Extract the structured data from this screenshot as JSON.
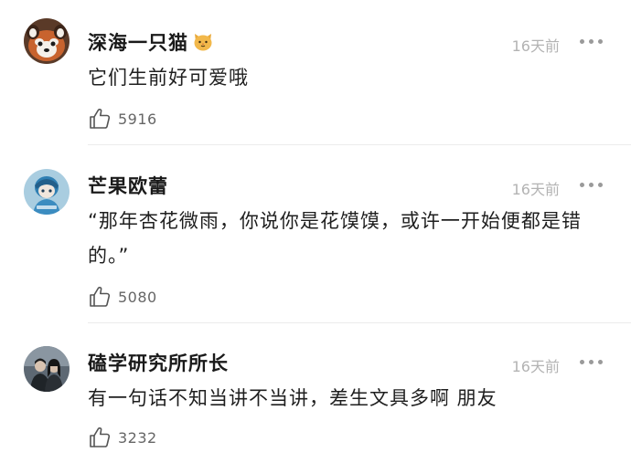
{
  "comments": [
    {
      "username": "深海一只猫",
      "time": "16天前",
      "text": "它们生前好可爱哦",
      "likes": "5916",
      "avatar_icon": "red-panda-avatar",
      "badge_icon": "cat-emoji-icon"
    },
    {
      "username": "芒果欧蕾",
      "time": "16天前",
      "text": "“那年杏花微雨，你说你是花馍馍，或许一开始便都是错的。”",
      "likes": "5080",
      "avatar_icon": "blue-character-avatar"
    },
    {
      "username": "磕学研究所所长",
      "time": "16天前",
      "text": "有一句话不知当讲不当讲，差生文具多啊 朋友",
      "likes": "3232",
      "avatar_icon": "couple-photo-avatar"
    }
  ],
  "colors": {
    "text": "#1f1f1f",
    "time": "#b3b3b3",
    "like_count": "#666666",
    "divider": "#ececec"
  }
}
